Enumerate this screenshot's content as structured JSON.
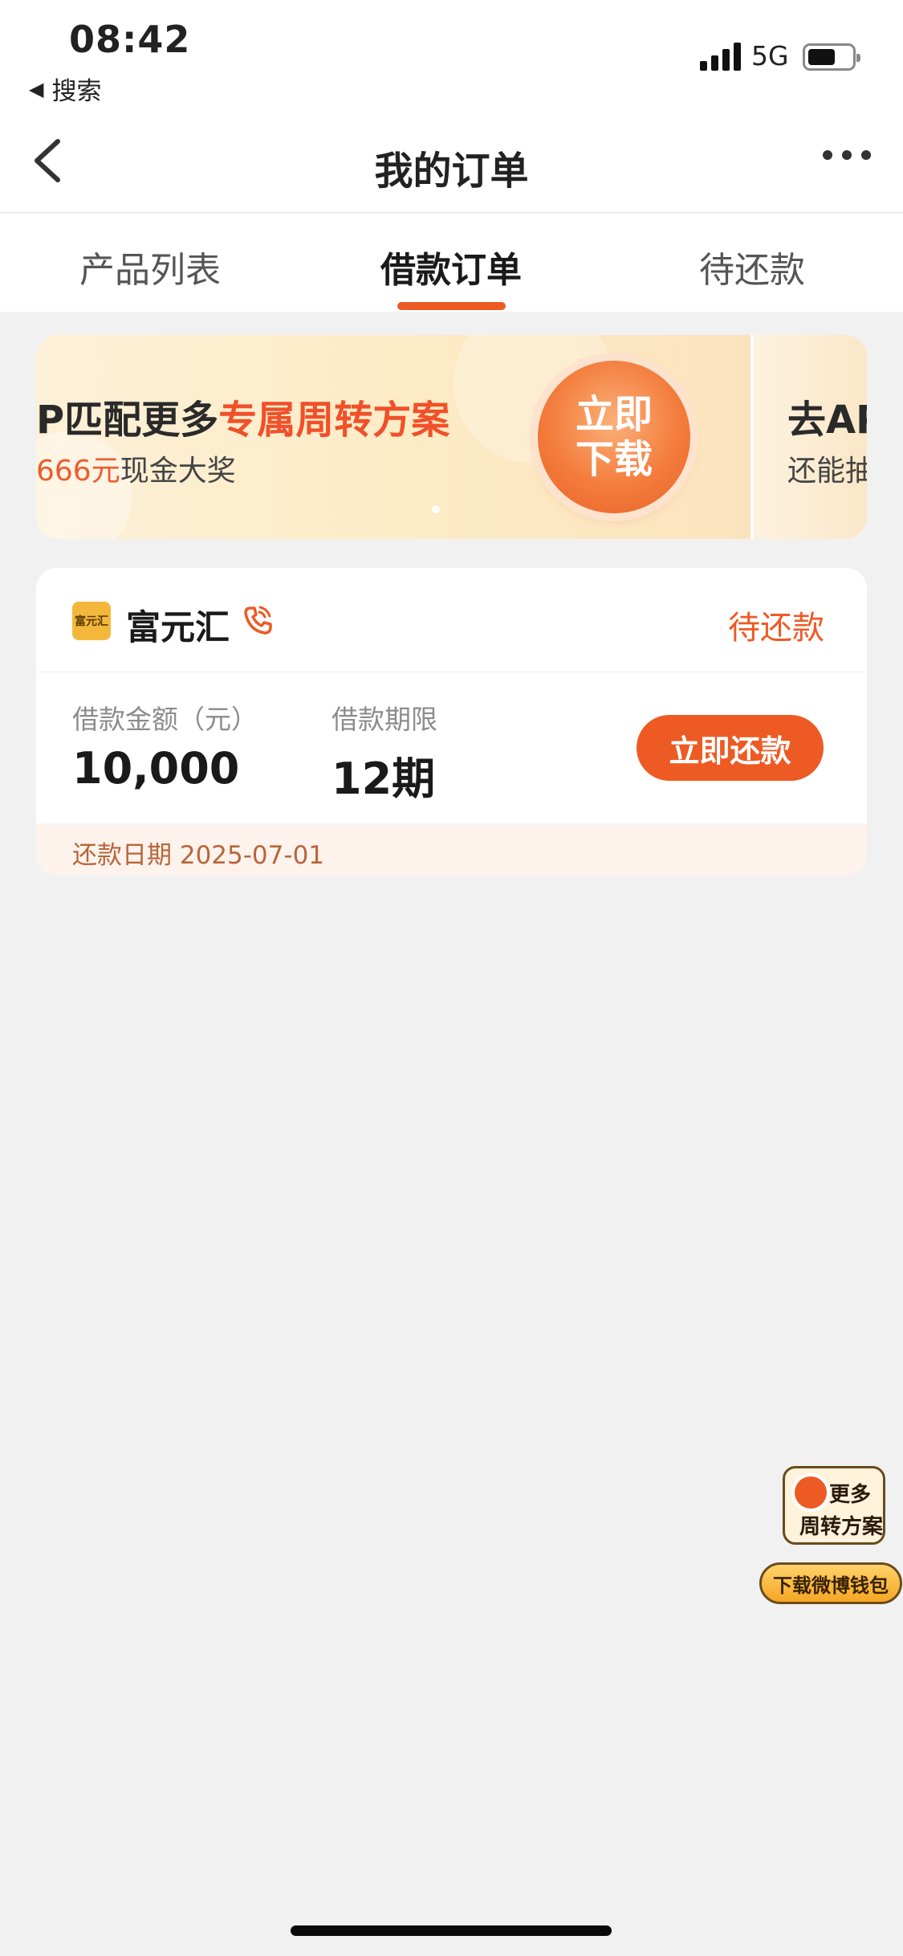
{
  "status_bar": {
    "time": "08:42",
    "back_label": "搜索",
    "network": "5G"
  },
  "nav": {
    "title": "我的订单"
  },
  "tabs": [
    {
      "label": "产品列表",
      "active": false
    },
    {
      "label": "借款订单",
      "active": true
    },
    {
      "label": "待还款",
      "active": false
    }
  ],
  "banner": {
    "line1_plain": "P匹配更多",
    "line1_highlight": "专属周转方案",
    "line2_highlight": "666元",
    "line2_plain": "现金大奖",
    "button_label": "立即下载",
    "next_line1": "去AP",
    "next_line2": "还能抽"
  },
  "order": {
    "lender_logo_text": "富元汇",
    "lender_name": "富元汇",
    "status": "待还款",
    "amount_label": "借款金额（元）",
    "amount_value": "10,000",
    "term_label": "借款期限",
    "term_value": "12期",
    "repay_button": "立即还款",
    "due_date_text": "还款日期 2025-07-01"
  },
  "floating_ad": {
    "line1": "更多",
    "line2": "周转方案",
    "button": "下载微博钱包"
  },
  "colors": {
    "accent": "#ee5a24",
    "background": "#f1f1f1",
    "banner_bg": "#fdecc6"
  }
}
